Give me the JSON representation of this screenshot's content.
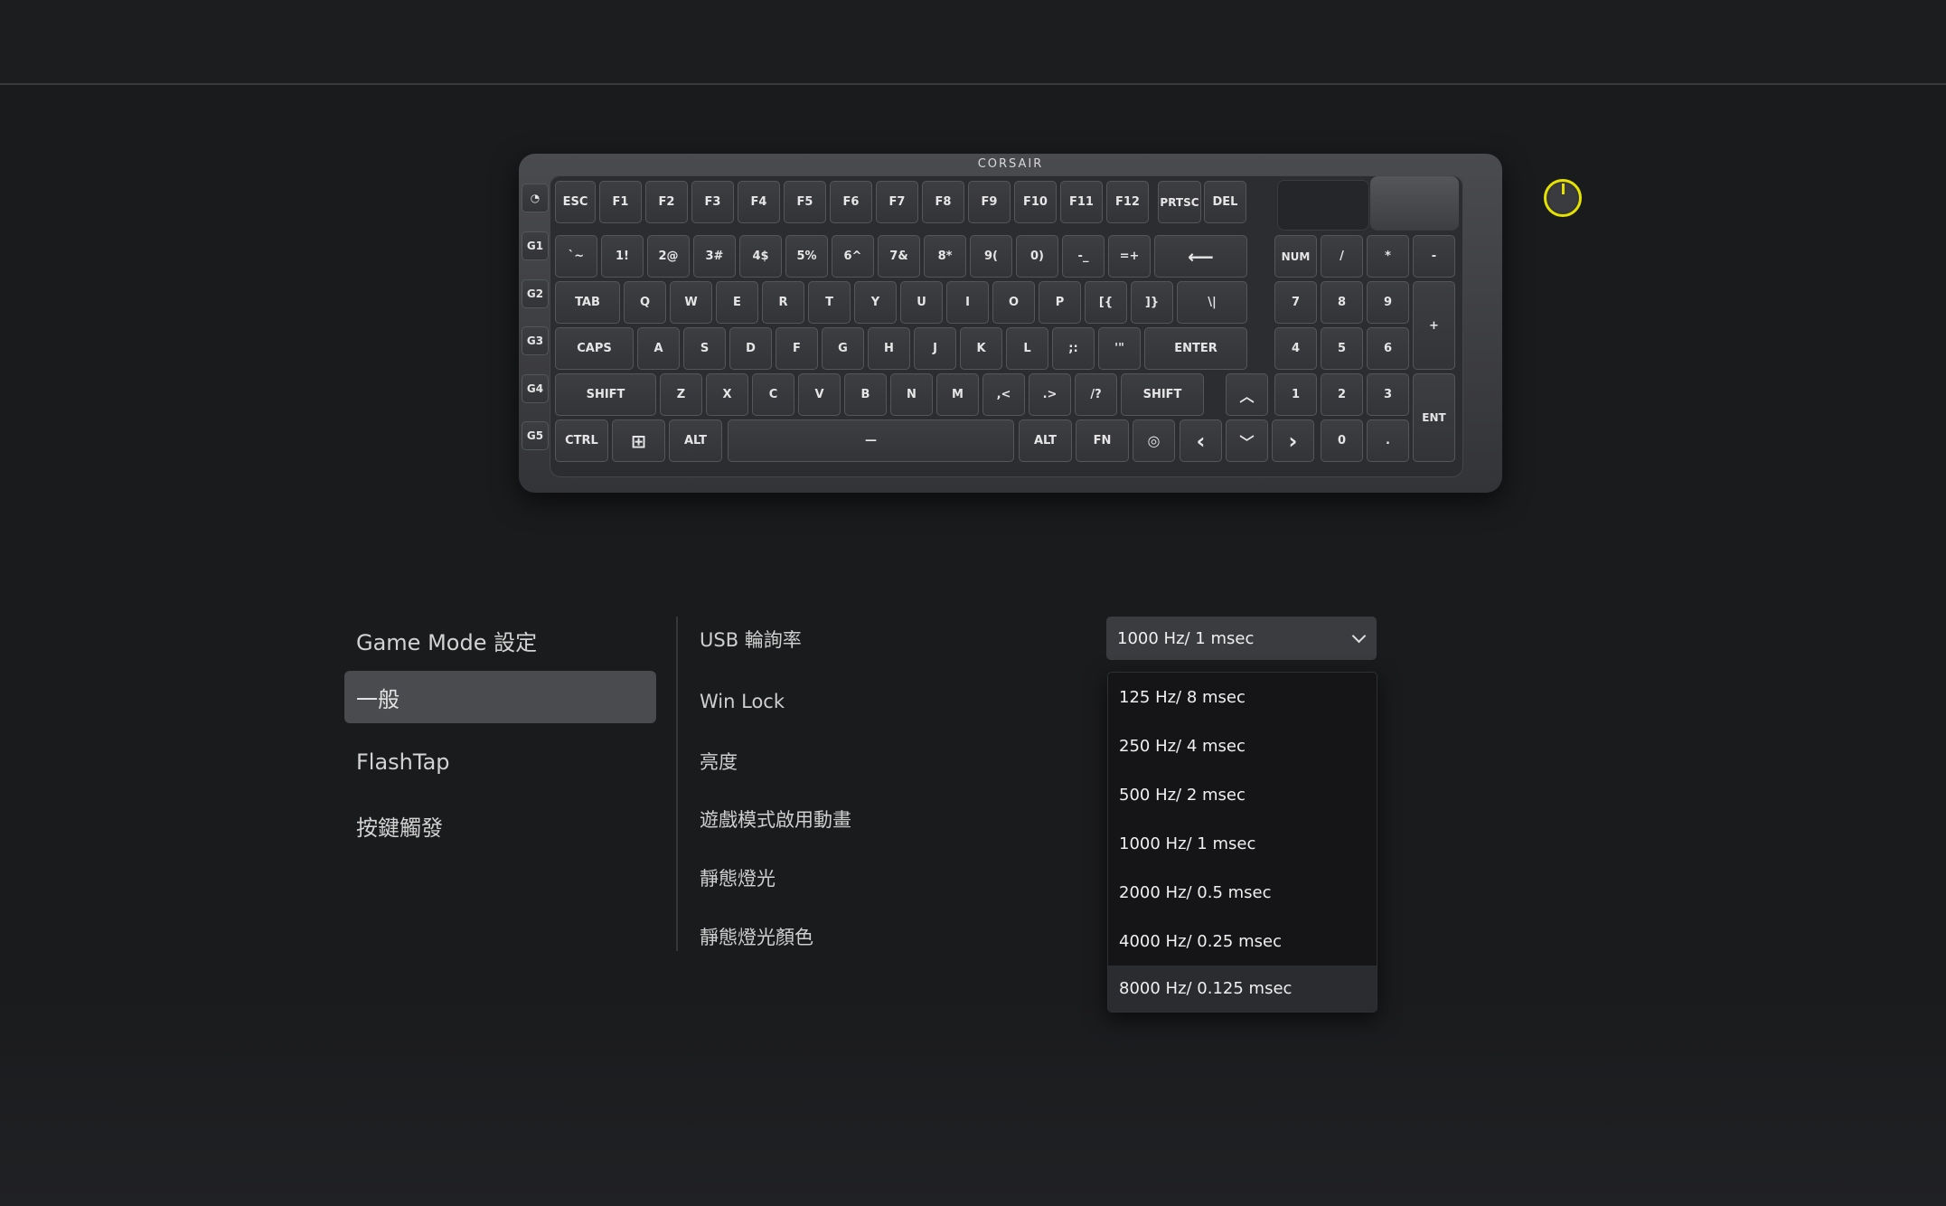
{
  "keyboard": {
    "brand": "CORSAIR",
    "gkeys": [
      "G1",
      "G2",
      "G3",
      "G4",
      "G5"
    ],
    "row_fn": [
      "ESC",
      "F1",
      "F2",
      "F3",
      "F4",
      "F5",
      "F6",
      "F7",
      "F8",
      "F9",
      "F10",
      "F11",
      "F12",
      "PRTSC",
      "DEL"
    ],
    "row_num": [
      "`~",
      "1!",
      "2@",
      "3#",
      "4$",
      "5%",
      "6^",
      "7&",
      "8*",
      "9(",
      "0)",
      "-_",
      "=+"
    ],
    "row_q": [
      "TAB",
      "Q",
      "W",
      "E",
      "R",
      "T",
      "Y",
      "U",
      "I",
      "O",
      "P",
      "[{",
      "]}",
      "\\|"
    ],
    "row_a": [
      "CAPS",
      "A",
      "S",
      "D",
      "F",
      "G",
      "H",
      "J",
      "K",
      "L",
      ";:",
      "'\"",
      "ENTER"
    ],
    "row_z": [
      "SHIFT",
      "Z",
      "X",
      "C",
      "V",
      "B",
      "N",
      "M",
      ",<",
      ".>",
      "/?",
      "SHIFT"
    ],
    "row_bottom": [
      "CTRL",
      "ALT",
      "ALT",
      "FN"
    ],
    "numpad": [
      "NUM",
      "/",
      "*",
      "-",
      "7",
      "8",
      "9",
      "+",
      "4",
      "5",
      "6",
      "1",
      "2",
      "3",
      "ENT",
      "0",
      "."
    ],
    "backspace_glyph": "⟵",
    "space_glyph": "—",
    "up_glyph": "︿",
    "left_glyph": "‹",
    "down_glyph": "﹀",
    "right_glyph": "›",
    "windows_glyph": "⊞",
    "copilot_glyph": "◎",
    "gauge_glyph": "◔"
  },
  "nav": {
    "title": "Game Mode 設定",
    "items": [
      "一般",
      "FlashTap",
      "按鍵觸發"
    ]
  },
  "settings": {
    "labels": [
      "USB 輪詢率",
      "Win Lock",
      "亮度",
      "遊戲模式啟用動畫",
      "靜態燈光",
      "靜態燈光顏色"
    ]
  },
  "polling": {
    "selected": "1000 Hz/ 1 msec",
    "options": [
      "125 Hz/ 8 msec",
      "250 Hz/ 4 msec",
      "500 Hz/ 2 msec",
      "1000 Hz/ 1 msec",
      "2000 Hz/ 0.5 msec",
      "4000 Hz/ 0.25 msec",
      "8000 Hz/ 0.125 msec"
    ]
  }
}
